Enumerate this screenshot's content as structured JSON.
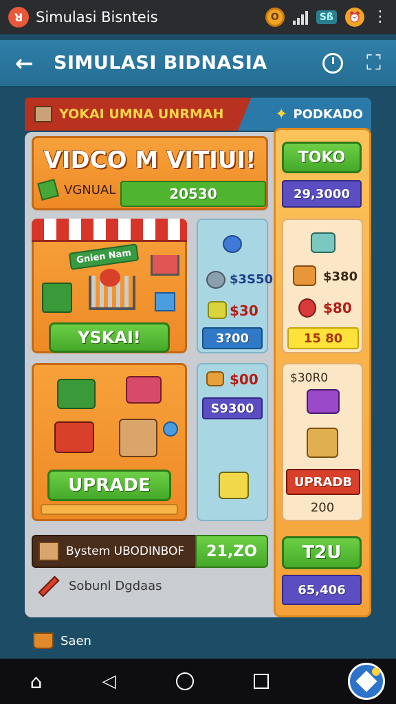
{
  "status_bar": {
    "app_title": "Simulasi Bisnteis",
    "circle_letter": "O",
    "network_chip": "Sß",
    "app_icon": "app-badge-icon",
    "alarm_icon": "alarm-icon"
  },
  "header": {
    "title": "SIMULASI BIDNASIA",
    "back_icon": "back-arrow-icon",
    "clock_icon": "clock-icon",
    "map_icon": "map-icon"
  },
  "banners": {
    "left_label": "YOKAI UMNA UNRMAH",
    "right_label": "PODKADO"
  },
  "title_card": {
    "title": "VIDCO M VITIUI!",
    "row_label": "VGNUAL",
    "row_value": "20530"
  },
  "shop_card": {
    "sign": "Gnien Nam",
    "button": "YSKAI!"
  },
  "mid_top": {
    "price1": "$3S50",
    "price2": "$30",
    "chip": "3?00"
  },
  "right_top": {
    "toko_button": "TOKO",
    "toko_value": "29,3000",
    "price1": "$380",
    "price2": "$80",
    "chip": "15 80"
  },
  "upgrade_card": {
    "button": "UPRADE"
  },
  "mid_bottom": {
    "price1": "$00",
    "chip": "S9300"
  },
  "right_bottom": {
    "label": "$30R0",
    "button": "UPRADB",
    "value": "200"
  },
  "system_row": {
    "label": "Bystem UBODINBOF",
    "value": "21,ZO"
  },
  "right_extra": {
    "button": "T2U",
    "value": "65,406"
  },
  "sobunl": {
    "label": "Sobunl Dgdaas"
  },
  "saen": {
    "label": "Saen"
  },
  "colors": {
    "primary_blue": "#2f7fa8",
    "orange": "#f7a13a",
    "green": "#4fb52f",
    "red_banner": "#b8321f"
  }
}
